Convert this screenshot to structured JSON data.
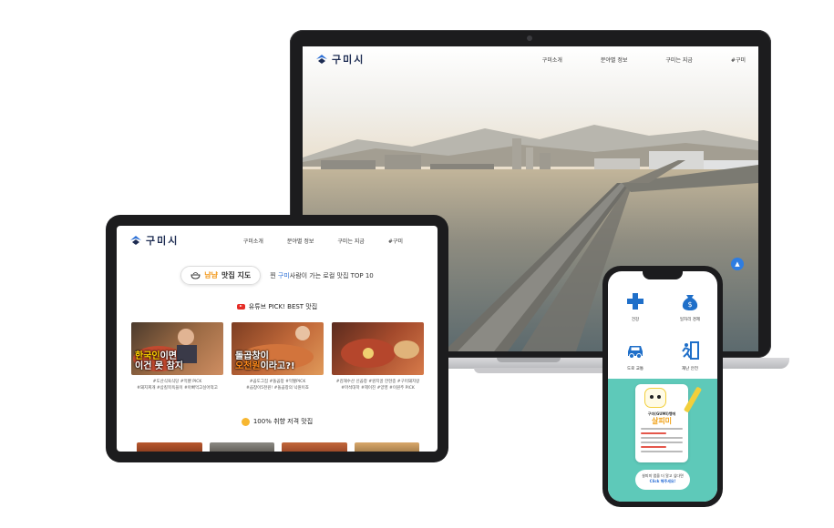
{
  "brand": {
    "name": "구미시"
  },
  "laptop": {
    "menu": [
      "구미소개",
      "분야별 정보",
      "구미는 지금",
      "#구미"
    ],
    "top_button": "▲"
  },
  "tablet": {
    "menu": [
      "구미소개",
      "분야별 정보",
      "구미는 지금",
      "#구미"
    ],
    "map_label_highlight": "냠냠",
    "map_label": "맛집 지도",
    "tagline_prefix": "찐 ",
    "tagline_highlight": "구미",
    "tagline_suffix": "사람이 가는 로컬 맛집 TOP 10",
    "youtube_section": "유튜브 PICK! BEST 맛집",
    "cards": [
      {
        "caption_line1_y": "한국인",
        "caption_line1": "이면",
        "caption_line2": "이건 못 참지",
        "tags": "#도산식육식당 #먹뱉 PICK\n#돼지찌개 #삼킬목욕을이 #아빠먹고싶어떡고"
      },
      {
        "caption_line1": "돌곱창이",
        "caption_line2_o": "오천원",
        "caption_line2": "이라고?!",
        "tags": "#곱도그집 #돌곱창 #먹뱉PICK\n#곱창이5천원! #돌곱창의 낙원이죠"
      },
      {
        "caption_line1": "",
        "caption_line2": "",
        "tags": "#김해수산 신곱창 #원지골 한현종 #구미돼지랑\n#마석대학 #헤이진 #양영 #이원주 PICK"
      }
    ],
    "taste_section": "100% 취향 저격 맛집"
  },
  "phone": {
    "grid": [
      {
        "icon": "medical-cross-icon",
        "label": "건강"
      },
      {
        "icon": "money-bag-icon",
        "label": "일자리 경제"
      },
      {
        "icon": "car-icon",
        "label": "도로 교통"
      },
      {
        "icon": "emergency-exit-icon",
        "label": "재난 안전"
      }
    ],
    "promo_title_small": "구미(GUMI)행에",
    "promo_title": "살피미",
    "promo_button_line1": "살피미 앱을 더 알고 싶다면",
    "promo_button_line2": "Click 해주세요!"
  },
  "colors": {
    "accent_blue": "#2f7de1",
    "brand_navy": "#1d2c52",
    "orange": "#f39a1e",
    "teal": "#5ec9b9"
  }
}
